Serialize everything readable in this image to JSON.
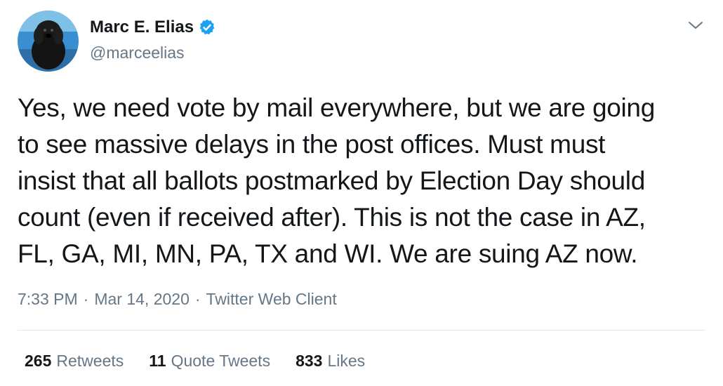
{
  "tweet": {
    "author": {
      "name": "Marc E. Elias",
      "handle": "@marceelias",
      "avatar_icon": "dog-avatar",
      "verified_icon": "verified-badge-icon",
      "verified_color": "#1da1f2"
    },
    "menu_icon": "chevron-down-icon",
    "text_lines": [
      "Yes, we need vote by mail everywhere, but we are going",
      "to see massive delays in the post offices. Must must",
      "insist that all ballots postmarked by Election Day should",
      "count (even if received after). This is not the case in AZ,",
      "FL, GA, MI, MN, PA, TX and WI. We are suing AZ now."
    ],
    "meta": {
      "time": "7:33 PM",
      "separator": "·",
      "date": "Mar 14, 2020",
      "client": "Twitter Web Client"
    },
    "stats": {
      "retweets": {
        "count": "265",
        "label": "Retweets"
      },
      "quote_tweets": {
        "count": "11",
        "label": "Quote Tweets"
      },
      "likes": {
        "count": "833",
        "label": "Likes"
      }
    }
  },
  "colors": {
    "text_primary": "#14171a",
    "text_secondary": "#657786",
    "divider": "#e1e8ed",
    "accent": "#1da1f2"
  }
}
